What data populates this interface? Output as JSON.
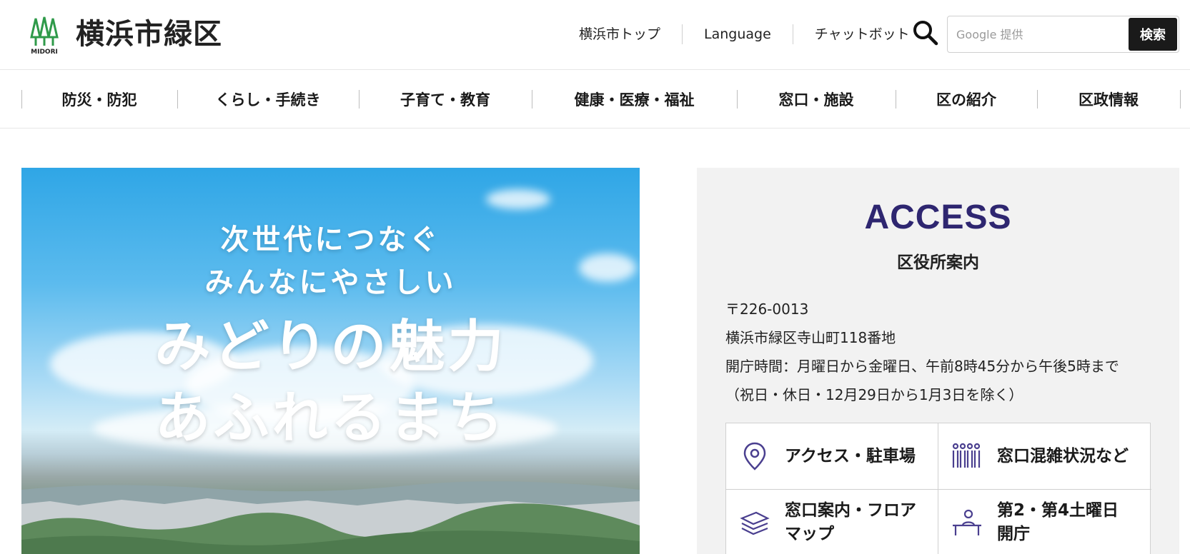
{
  "header": {
    "logo_text": "MIDORI",
    "site_title": "横浜市緑区",
    "util_links": [
      "横浜市トップ",
      "Language",
      "チャットボット"
    ],
    "search": {
      "placeholder": "Google 提供",
      "button_label": "検索"
    }
  },
  "nav": {
    "items": [
      "防災・防犯",
      "くらし・手続き",
      "子育て・教育",
      "健康・医療・福祉",
      "窓口・施設",
      "区の紹介",
      "区政情報"
    ]
  },
  "hero": {
    "line1": "次世代につなぐ",
    "line2": "みんなにやさしい",
    "line3": "みどりの魅力",
    "line4": "あふれるまち"
  },
  "access": {
    "title": "ACCESS",
    "subtitle": "区役所案内",
    "postal": "〒226-0013",
    "address": "横浜市緑区寺山町118番地",
    "hours": "開庁時間：月曜日から金曜日、午前8時45分から午後5時まで",
    "hours_note": "（祝日・休日・12月29日から1月3日を除く）",
    "tiles": [
      {
        "label": "アクセス・駐車場",
        "icon": "map-pin-icon"
      },
      {
        "label": "窓口混雑状況など",
        "icon": "queue-people-icon"
      },
      {
        "label_line1": "窓口案内・フロア",
        "label_line2": "マップ",
        "icon": "floor-layers-icon"
      },
      {
        "label_line1": "第2・第4土曜日",
        "label_line2": "開庁",
        "icon": "counter-staff-icon"
      }
    ]
  },
  "colors": {
    "accent": "#2e2670",
    "icon": "#4a3f8f",
    "logo_green": "#2f9a4a",
    "panel_bg": "#f2f2f2"
  }
}
